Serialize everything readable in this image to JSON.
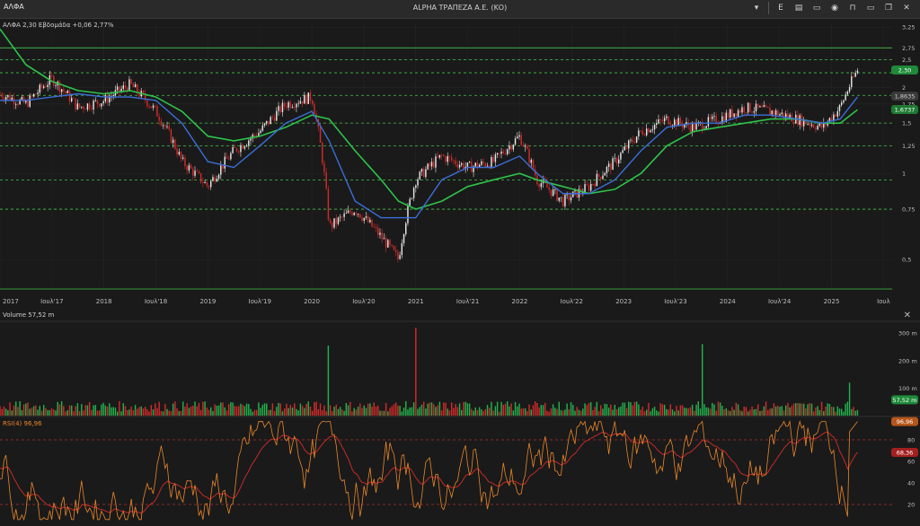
{
  "window": {
    "tab_title": "ΑΛΦΑ",
    "title": "ALPHA ΤΡΑΠΕΖΑ Α.Ε. (ΚΟ)",
    "toolbar_letter": "E"
  },
  "main_legend": "ΑΛΦΑ 2,30 Εβδομάδα +0,06 2,77%",
  "volume_legend": "Volume  57,52 m",
  "rsi_legend": "RSI(4)  96,96",
  "colors": {
    "up": "#22b24c",
    "down": "#d42a2a",
    "sma_fast": "#3a6fd8",
    "sma_slow": "#2ec24a",
    "rsi": "#e8862a",
    "rsi_ma": "#c42a2a",
    "hline": "#45c24a"
  },
  "chart_data": [
    {
      "type": "candlestick",
      "interval": "Εβδομάδα",
      "yscale": "log",
      "ylim": [
        0.4,
        3.35
      ],
      "y_ticks": [
        "3,25",
        "2,75",
        "2,5",
        "2",
        "1,75",
        "1,5",
        "1,25",
        "1",
        "0,75",
        "0,5"
      ],
      "y_tick_values": [
        3.25,
        2.75,
        2.5,
        2,
        1.75,
        1.5,
        1.25,
        1,
        0.75,
        0.5
      ],
      "x_ticks": [
        "2017",
        "Ιουλ'17",
        "2018",
        "Ιουλ'18",
        "2019",
        "Ιουλ'19",
        "2020",
        "Ιουλ'20",
        "2021",
        "Ιουλ'21",
        "2022",
        "Ιουλ'22",
        "2023",
        "Ιουλ'23",
        "2024",
        "Ιουλ'24",
        "2025",
        "Ιουλ"
      ],
      "x_range": [
        "2017-01",
        "2025-08"
      ],
      "horizontal_levels": [
        2.75,
        2.5,
        2.25,
        1.875,
        1.5,
        1.25,
        0.95,
        0.75
      ],
      "price_path": {
        "x": [
          "2017-01",
          "2017-04",
          "2017-07",
          "2017-10",
          "2018-01",
          "2018-04",
          "2018-07",
          "2018-10",
          "2019-01",
          "2019-04",
          "2019-07",
          "2019-10",
          "2020-01",
          "2020-03",
          "2020-06",
          "2020-09",
          "2020-11",
          "2021-01",
          "2021-04",
          "2021-07",
          "2021-10",
          "2022-01",
          "2022-03",
          "2022-06",
          "2022-09",
          "2022-12",
          "2023-03",
          "2023-06",
          "2023-09",
          "2023-12",
          "2024-03",
          "2024-06",
          "2024-09",
          "2024-12",
          "2025-02",
          "2025-04"
        ],
        "close": [
          1.9,
          1.75,
          2.15,
          1.7,
          1.8,
          2.05,
          1.65,
          1.1,
          0.9,
          1.2,
          1.4,
          1.75,
          1.85,
          0.65,
          0.75,
          0.6,
          0.5,
          0.95,
          1.15,
          1.05,
          1.1,
          1.35,
          0.95,
          0.8,
          0.9,
          1.1,
          1.4,
          1.55,
          1.45,
          1.55,
          1.7,
          1.65,
          1.55,
          1.45,
          1.7,
          2.3
        ]
      },
      "last_price": "2,30",
      "sma_fast_last": "1,8635",
      "sma_slow_last": "1,6737",
      "sma_fast_path": [
        1.8,
        1.8,
        1.85,
        1.9,
        1.85,
        1.85,
        1.8,
        1.5,
        1.1,
        1.05,
        1.25,
        1.5,
        1.65,
        1.3,
        0.8,
        0.7,
        0.7,
        0.7,
        0.95,
        1.05,
        1.05,
        1.15,
        1.0,
        0.85,
        0.85,
        0.95,
        1.2,
        1.45,
        1.5,
        1.5,
        1.6,
        1.6,
        1.55,
        1.5,
        1.55,
        1.85
      ],
      "sma_slow_path": [
        3.2,
        2.4,
        2.1,
        1.95,
        1.9,
        1.95,
        1.85,
        1.65,
        1.35,
        1.3,
        1.35,
        1.45,
        1.6,
        1.55,
        1.2,
        0.95,
        0.8,
        0.75,
        0.8,
        0.9,
        0.95,
        1.0,
        0.95,
        0.9,
        0.85,
        0.88,
        1.0,
        1.25,
        1.4,
        1.45,
        1.5,
        1.55,
        1.55,
        1.5,
        1.5,
        1.67
      ]
    },
    {
      "type": "bar",
      "title": "Volume",
      "last_value": "57,52 m",
      "y_ticks": [
        "300 m",
        "200 m",
        "100 m"
      ],
      "y_tick_values": [
        300,
        200,
        100
      ],
      "ylim": [
        0,
        330
      ],
      "spikes": [
        {
          "date": "2020-03",
          "value": 255,
          "direction": "up"
        },
        {
          "date": "2021-01",
          "value": 320,
          "direction": "down"
        },
        {
          "date": "2023-10",
          "value": 260,
          "direction": "up"
        },
        {
          "date": "2025-03",
          "value": 120,
          "direction": "up"
        }
      ],
      "typical_value": 35
    },
    {
      "type": "line",
      "title": "RSI(4)",
      "last_value": "96,96",
      "ma_last_value": "68,36",
      "y_ticks": [
        "80",
        "60",
        "40",
        "20"
      ],
      "y_tick_values": [
        80,
        60,
        40,
        20
      ],
      "ylim": [
        0,
        100
      ],
      "bands": [
        20,
        80
      ]
    }
  ]
}
